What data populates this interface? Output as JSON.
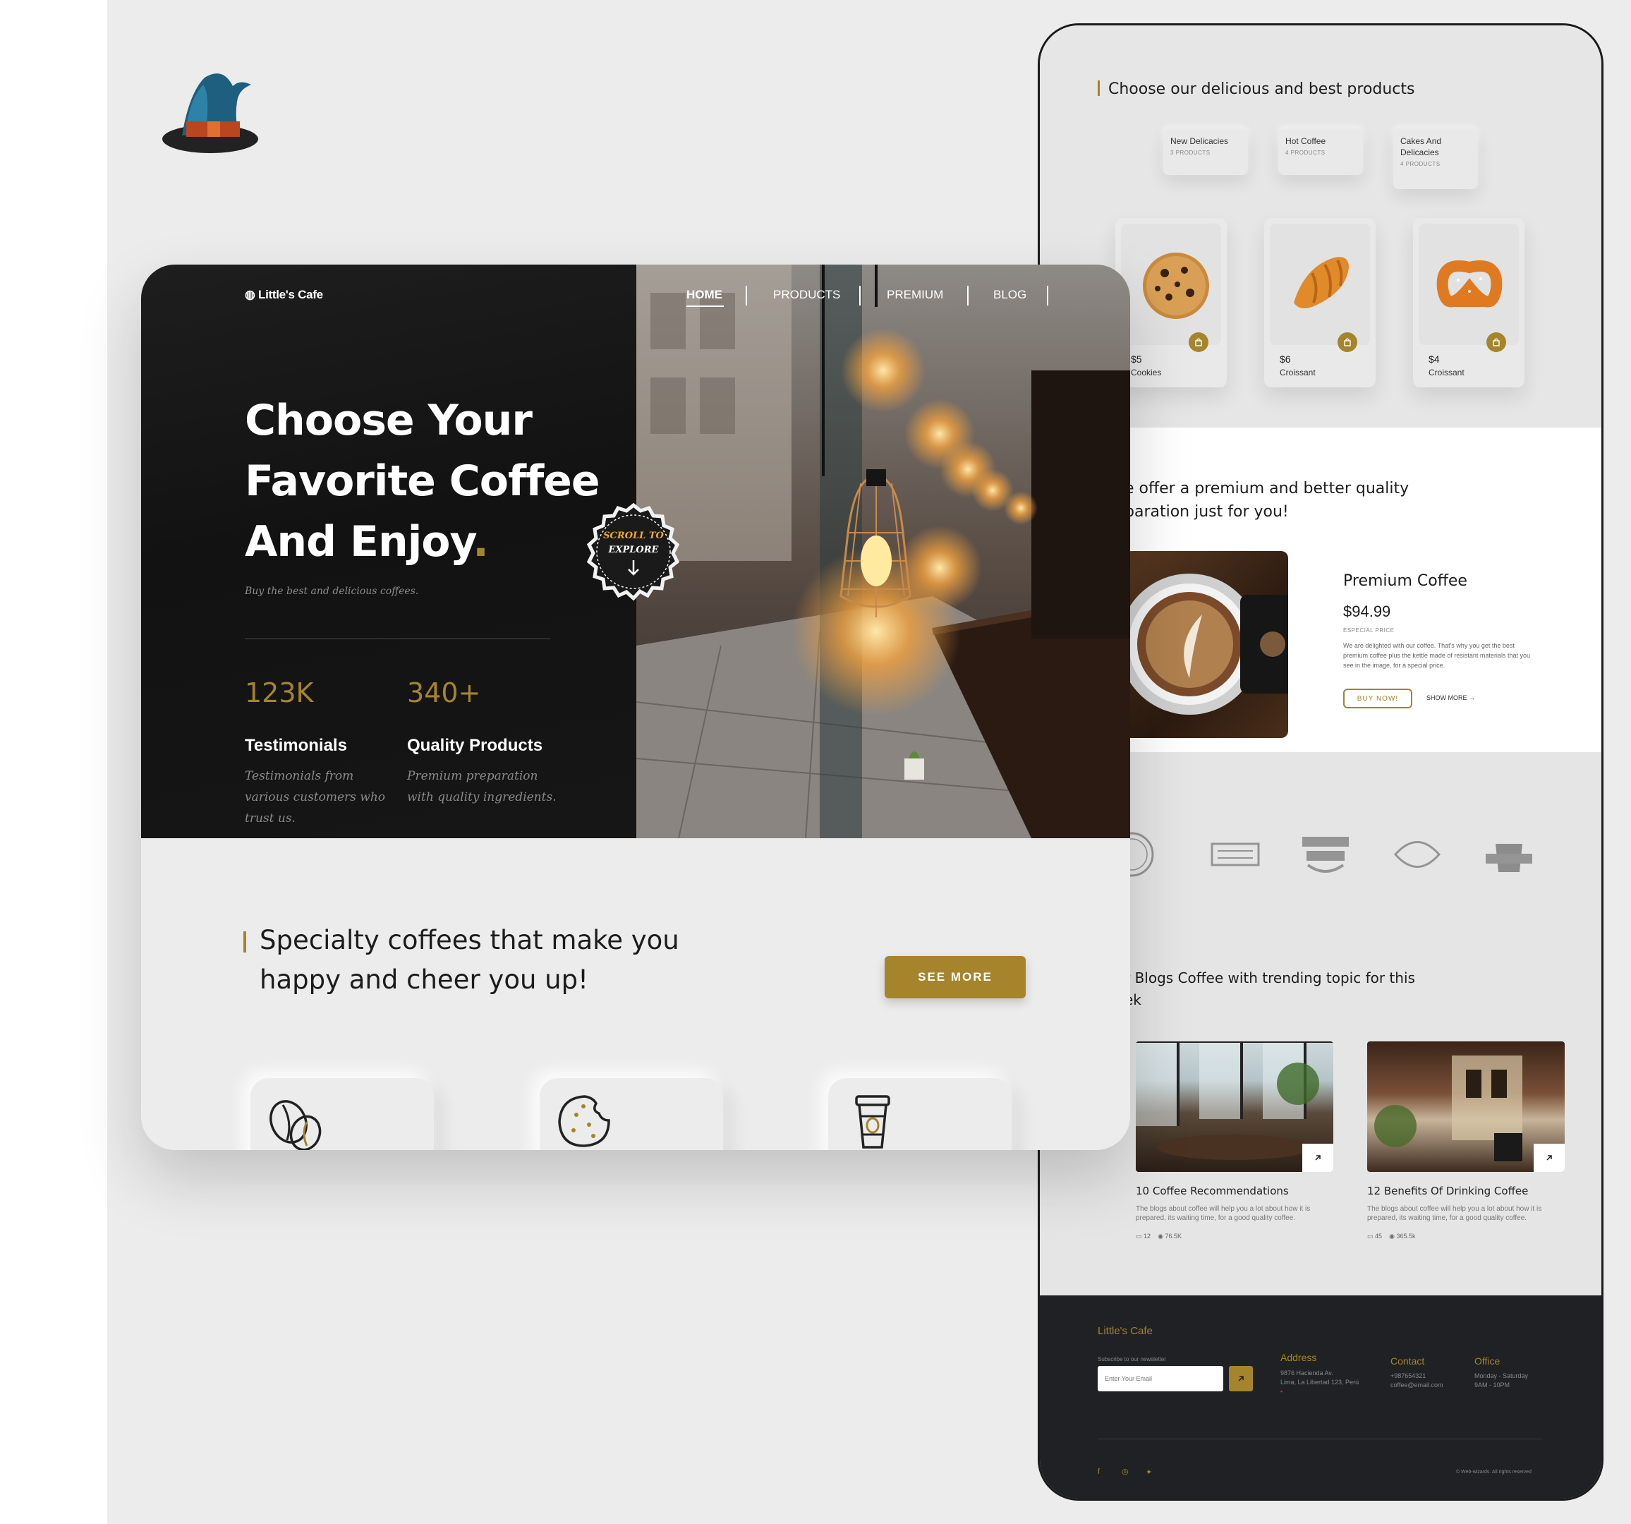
{
  "phone": {
    "products_heading": "Choose our delicious and best products",
    "categories": [
      {
        "name": "New Delicacies",
        "count": "3 PRODUCTS"
      },
      {
        "name": "Hot Coffee",
        "count": "4 PRODUCTS"
      },
      {
        "name": "Cakes And Delicacies",
        "count": "4 PRODUCTS"
      }
    ],
    "products": [
      {
        "price": "$5",
        "name": "Cookies"
      },
      {
        "price": "$6",
        "name": "Croissant"
      },
      {
        "price": "$4",
        "name": "Croissant"
      }
    ],
    "premium_heading_1": "e offer a premium and better quality",
    "premium_heading_2": "paration just for you!",
    "premium": {
      "title": "Premium Coffee",
      "price": "$94.99",
      "price_label": "ESPECIAL PRICE",
      "description": "We are delighted with our coffee. That's why you get the best premium coffee plus the kettle made of resistant materials that you see in the image, for a special price.",
      "buy_label": "BUY NOW!",
      "show_more_label": "SHOW MORE"
    },
    "blogs_heading_1": "r Blogs Coffee with trending topic for this",
    "blogs_heading_2": "ek",
    "blogs": [
      {
        "title": "10 Coffee Recommendations",
        "description": "The blogs about coffee will help you a lot about how it is prepared, its waiting time, for a good quality coffee.",
        "comments": "12",
        "views": "76.5K"
      },
      {
        "title": "12 Benefits Of Drinking Coffee",
        "description": "The blogs about coffee will help you a lot about how it is prepared, its waiting time, for a good quality coffee.",
        "comments": "45",
        "views": "365.5k"
      }
    ],
    "footer": {
      "brand": "Little's Cafe",
      "newsletter_label": "Subscribe to our newsletter",
      "email_placeholder": "Enter Your Email",
      "address_title": "Address",
      "address_lines": [
        "9876 Hacienda Av.",
        "Lima, La Libertad 123, Perú"
      ],
      "contact_title": "Contact",
      "contact_lines": [
        "+987654321",
        "coffee@email.com"
      ],
      "office_title": "Office",
      "office_lines": [
        "Monday - Saturday",
        "9AM - 10PM"
      ],
      "copyright": "© Web-wizards. All rights reserved"
    }
  },
  "desktop": {
    "brand": "Little's Cafe",
    "nav": [
      "HOME",
      "PRODUCTS",
      "PREMIUM",
      "BLOG"
    ],
    "hero_title_1": "Choose Your",
    "hero_title_2": "Favorite Coffee",
    "hero_title_3": "And Enjoy",
    "hero_title_dot": ".",
    "hero_subtitle": "Buy the best and delicious coffees.",
    "scroll_badge_1": "SCROLL TO",
    "scroll_badge_2": "EXPLORE",
    "stats": [
      {
        "value": "123K",
        "title": "Testimonials",
        "description": "Testimonials from various customers who trust us."
      },
      {
        "value": "340+",
        "title": "Quality Products",
        "description": "Premium preparation with quality ingredients."
      }
    ],
    "specialty_heading_1": "Specialty coffees that make you",
    "specialty_heading_2": "happy and cheer you up!",
    "see_more_label": "SEE MORE"
  },
  "colors": {
    "accent": "#a5842c",
    "dark": "#141414",
    "background": "#ececec",
    "footer": "#1f2124"
  },
  "icons": [
    "wizard-hat-icon",
    "coffee-bean-icon",
    "cookie-icon",
    "coffee-cup-icon",
    "bag-icon",
    "arrow-down-icon",
    "arrow-up-right-icon",
    "comment-icon",
    "eye-icon",
    "facebook-icon",
    "instagram-icon",
    "twitter-icon"
  ]
}
